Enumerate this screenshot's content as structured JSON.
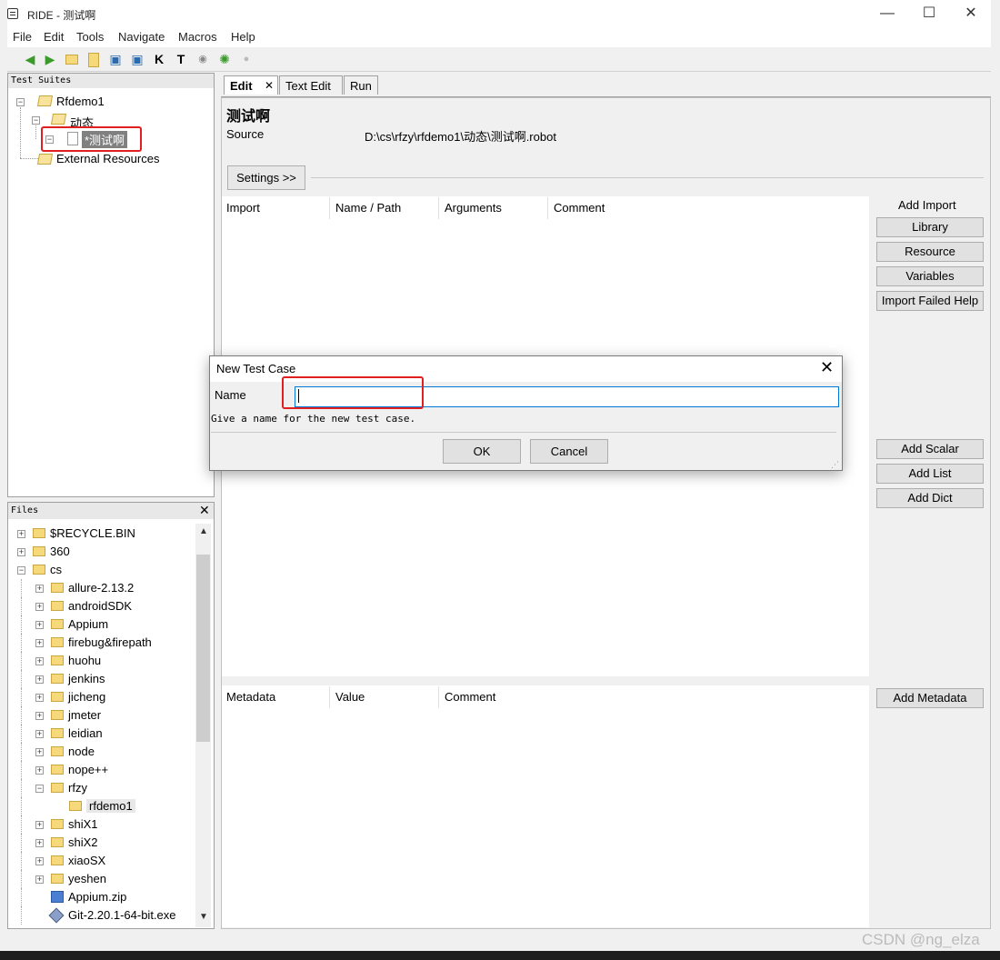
{
  "window": {
    "title": "RIDE - 测试啊",
    "minimize": "—",
    "maximize": "☐",
    "close": "✕"
  },
  "menu": [
    {
      "label": "File"
    },
    {
      "label": "Edit"
    },
    {
      "label": "Tools"
    },
    {
      "label": "Navigate"
    },
    {
      "label": "Macros"
    },
    {
      "label": "Help"
    }
  ],
  "toolbar": [
    "back-arrow-icon",
    "forward-arrow-icon",
    "open-folder-icon",
    "new-file-icon",
    "open-suite-icon",
    "open-dir-icon",
    "keyword-search-icon",
    "test-search-icon",
    "run-icon",
    "bug-icon",
    "stop-icon"
  ],
  "tree": {
    "header": "Test Suites",
    "root": "Rfdemo1",
    "child_folder": "动态",
    "selected_file": "*测试啊",
    "external": "External Resources"
  },
  "files": {
    "header": "Files",
    "close": "✕",
    "items": [
      {
        "label": "$RECYCLE.BIN",
        "level": 0,
        "expand": "+"
      },
      {
        "label": "360",
        "level": 0,
        "expand": "+"
      },
      {
        "label": "cs",
        "level": 0,
        "expand": "−"
      },
      {
        "label": "allure-2.13.2",
        "level": 1,
        "expand": "+"
      },
      {
        "label": "androidSDK",
        "level": 1,
        "expand": "+"
      },
      {
        "label": "Appium",
        "level": 1,
        "expand": "+"
      },
      {
        "label": "firebug&firepath",
        "level": 1,
        "expand": "+"
      },
      {
        "label": "huohu",
        "level": 1,
        "expand": "+"
      },
      {
        "label": "jenkins",
        "level": 1,
        "expand": "+"
      },
      {
        "label": "jicheng",
        "level": 1,
        "expand": "+"
      },
      {
        "label": "jmeter",
        "level": 1,
        "expand": "+"
      },
      {
        "label": "leidian",
        "level": 1,
        "expand": "+"
      },
      {
        "label": "node",
        "level": 1,
        "expand": "+"
      },
      {
        "label": "nope++",
        "level": 1,
        "expand": "+"
      },
      {
        "label": "rfzy",
        "level": 1,
        "expand": "−"
      },
      {
        "label": "rfdemo1",
        "level": 2,
        "expand": ""
      },
      {
        "label": "shiX1",
        "level": 1,
        "expand": "+"
      },
      {
        "label": "shiX2",
        "level": 1,
        "expand": "+"
      },
      {
        "label": "xiaoSX",
        "level": 1,
        "expand": "+"
      },
      {
        "label": "yeshen",
        "level": 1,
        "expand": "+"
      },
      {
        "label": "Appium.zip",
        "level": 1,
        "expand": ""
      },
      {
        "label": "Git-2.20.1-64-bit.exe",
        "level": 1,
        "expand": ""
      }
    ]
  },
  "tabs": [
    {
      "label": "Edit",
      "close": "✕"
    },
    {
      "label": "Text Edit"
    },
    {
      "label": "Run"
    }
  ],
  "editor": {
    "suite_name": "测试啊",
    "source_label": "Source",
    "source_value": "D:\\cs\\rfzy\\rfdemo1\\动态\\测试啊.robot",
    "settings_button": "Settings >>",
    "import_headers": [
      "Import",
      "Name / Path",
      "Arguments",
      "Comment"
    ],
    "add_import_label": "Add Import",
    "import_buttons": [
      "Library",
      "Resource",
      "Variables",
      "Import Failed Help"
    ],
    "variable_buttons": [
      "Add Scalar",
      "Add List",
      "Add Dict"
    ],
    "metadata_headers": [
      "Metadata",
      "Value",
      "Comment"
    ],
    "add_metadata": "Add Metadata"
  },
  "dialog": {
    "title": "New Test Case",
    "close": "✕",
    "name_label": "Name",
    "name_value": "",
    "hint": "Give a name for the new test case.",
    "ok": "OK",
    "cancel": "Cancel"
  },
  "watermark": "CSDN @ng_elza",
  "colors": {
    "highlight": "#e02020",
    "focus": "#0078d7",
    "folder": "#f5d97a"
  }
}
